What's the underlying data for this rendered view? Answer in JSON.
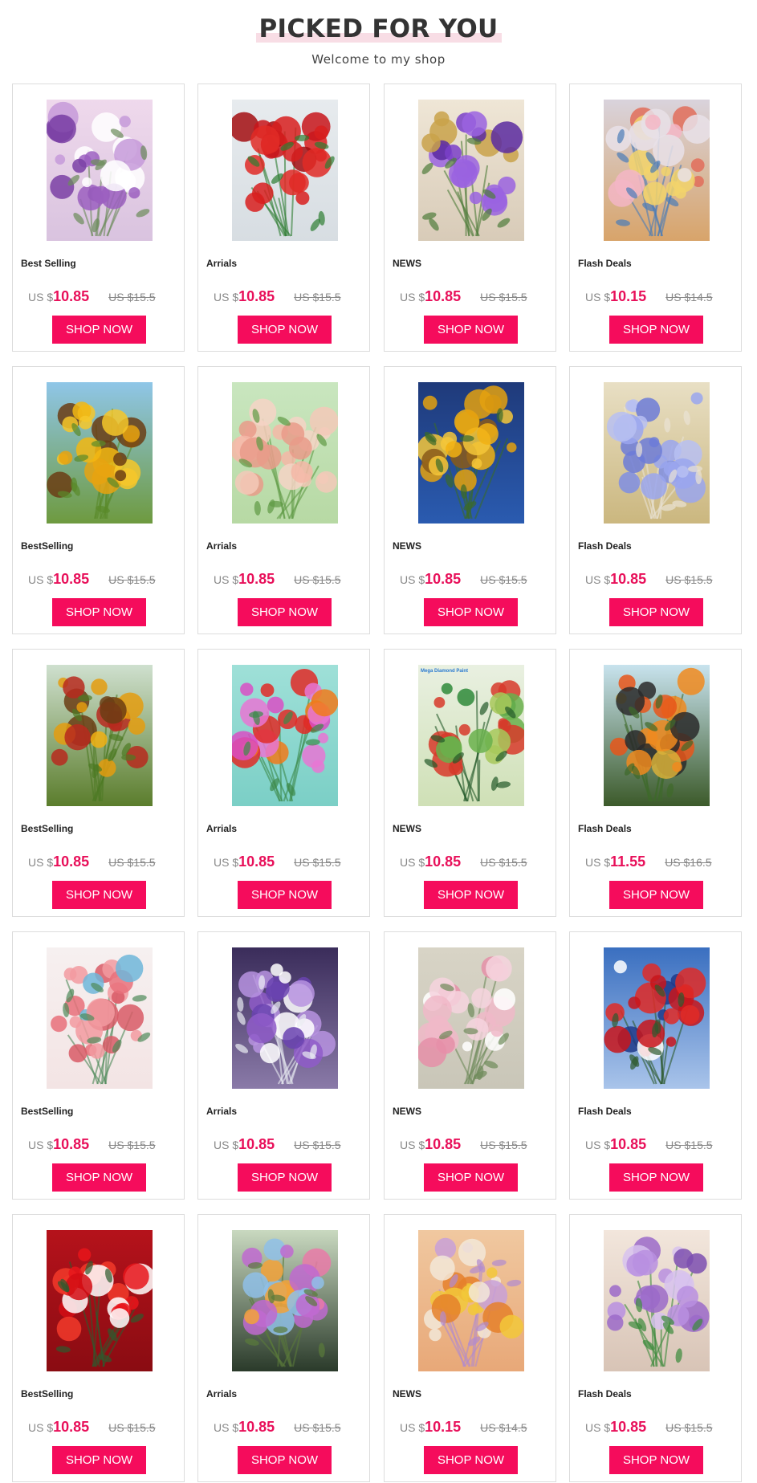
{
  "header": {
    "title": "PICKED FOR YOU",
    "subtitle": "Welcome to my shop"
  },
  "colors": {
    "accent": "#f50c5c",
    "price": "#e8105a",
    "title_underline": "#f8dde5"
  },
  "products": [
    {
      "category": "Best Selling",
      "currency": "US $",
      "price": "10.85",
      "old_price": "US $15.5",
      "button": "SHOP NOW",
      "image": "purple-flowers-vase-painting"
    },
    {
      "category": "Arrials",
      "currency": "US $",
      "price": "10.85",
      "old_price": "US $15.5",
      "button": "SHOP NOW",
      "image": "red-roses-painting"
    },
    {
      "category": "NEWS",
      "currency": "US $",
      "price": "10.85",
      "old_price": "US $15.5",
      "button": "SHOP NOW",
      "image": "hummingbirds-purple-flowers-painting"
    },
    {
      "category": "Flash Deals",
      "currency": "US $",
      "price": "10.15",
      "old_price": "US $14.5",
      "button": "SHOP NOW",
      "image": "bouquet-blue-vase-painting"
    },
    {
      "category": "BestSelling",
      "currency": "US $",
      "price": "10.85",
      "old_price": "US $15.5",
      "button": "SHOP NOW",
      "image": "sunflowers-sky-painting"
    },
    {
      "category": "Arrials",
      "currency": "US $",
      "price": "10.85",
      "old_price": "US $15.5",
      "button": "SHOP NOW",
      "image": "pink-roses-painting"
    },
    {
      "category": "NEWS",
      "currency": "US $",
      "price": "10.85",
      "old_price": "US $15.5",
      "button": "SHOP NOW",
      "image": "sunflower-dragonfly-painting"
    },
    {
      "category": "Flash Deals",
      "currency": "US $",
      "price": "10.85",
      "old_price": "US $15.5",
      "button": "SHOP NOW",
      "image": "blue-flowers-vase-painting"
    },
    {
      "category": "BestSelling",
      "currency": "US $",
      "price": "10.85",
      "old_price": "US $15.5",
      "button": "SHOP NOW",
      "image": "sunflower-field-barn-painting"
    },
    {
      "category": "Arrials",
      "currency": "US $",
      "price": "10.85",
      "old_price": "US $15.5",
      "button": "SHOP NOW",
      "image": "hibiscus-hummingbirds-painting"
    },
    {
      "category": "NEWS",
      "currency": "US $",
      "price": "10.85",
      "old_price": "US $15.5",
      "button": "SHOP NOW",
      "image": "tropical-plants-collage",
      "image_label": "Mega Diamond Paint"
    },
    {
      "category": "Flash Deals",
      "currency": "US $",
      "price": "11.55",
      "old_price": "US $16.5",
      "button": "SHOP NOW",
      "image": "butterflies-painting"
    },
    {
      "category": "BestSelling",
      "currency": "US $",
      "price": "10.85",
      "old_price": "US $15.5",
      "button": "SHOP NOW",
      "image": "butterfly-pink-roses-painting"
    },
    {
      "category": "Arrials",
      "currency": "US $",
      "price": "10.85",
      "old_price": "US $15.5",
      "button": "SHOP NOW",
      "image": "daisies-white-vase-painting"
    },
    {
      "category": "NEWS",
      "currency": "US $",
      "price": "10.85",
      "old_price": "US $15.5",
      "button": "SHOP NOW",
      "image": "peonies-vase-painting"
    },
    {
      "category": "Flash Deals",
      "currency": "US $",
      "price": "10.85",
      "old_price": "US $15.5",
      "button": "SHOP NOW",
      "image": "flag-rose-painting"
    },
    {
      "category": "BestSelling",
      "currency": "US $",
      "price": "10.85",
      "old_price": "US $15.5",
      "button": "SHOP NOW",
      "image": "red-gerberas-butterfly-painting"
    },
    {
      "category": "Arrials",
      "currency": "US $",
      "price": "10.85",
      "old_price": "US $15.5",
      "button": "SHOP NOW",
      "image": "dandelion-pompom-flowers-painting"
    },
    {
      "category": "NEWS",
      "currency": "US $",
      "price": "10.15",
      "old_price": "US $14.5",
      "button": "SHOP NOW",
      "image": "wildflower-bouquet-painting"
    },
    {
      "category": "Flash Deals",
      "currency": "US $",
      "price": "10.85",
      "old_price": "US $15.5",
      "button": "SHOP NOW",
      "image": "purple-roses-vase-painting"
    }
  ]
}
